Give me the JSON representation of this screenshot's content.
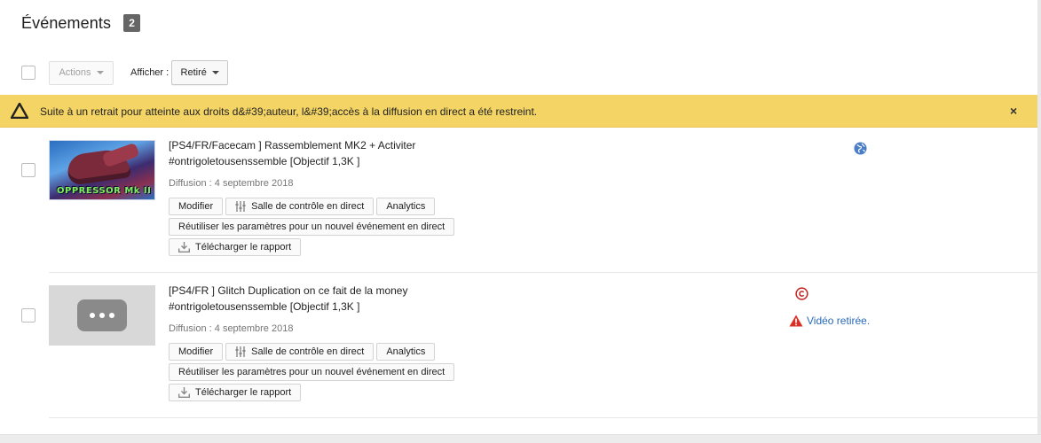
{
  "header": {
    "title": "Événements",
    "count": "2"
  },
  "toolbar": {
    "actions_label": "Actions",
    "filter_label": "Afficher :",
    "filter_value": "Retiré"
  },
  "alert": {
    "text": "Suite à un retrait pour atteinte aux droits d&#39;auteur, l&#39;accès à la diffusion en direct a été restreint.",
    "close": "×",
    "color": "#f4d464"
  },
  "events": [
    {
      "title_line1": "[PS4/FR/Facecam ] Rassemblement MK2 + Activiter",
      "title_line2": "#ontrigoletousenssemble [Objectif 1,3K ]",
      "date": "Diffusion : 4 septembre 2018",
      "thumb_text": "OPPRESSOR Mk II",
      "status_icon": "globe-icon"
    },
    {
      "title_line1": "[PS4/FR ] Glitch Duplication on ce fait de la money",
      "title_line2": "#ontrigoletousenssemble [Objectif 1,3K ]",
      "date": "Diffusion : 4 septembre 2018",
      "status_icon": "copyright-icon",
      "status_text": "Vidéo retirée."
    }
  ],
  "buttons": {
    "edit": "Modifier",
    "control_room": "Salle de contrôle en direct",
    "analytics": "Analytics",
    "reuse": "Réutiliser les paramètres pour un nouvel événement en direct",
    "download": "Télécharger le rapport"
  },
  "colors": {
    "link": "#2a6ab8",
    "warning_red": "#d93025",
    "copyright_red": "#c5221f",
    "globe_blue": "#4a7ec8"
  }
}
